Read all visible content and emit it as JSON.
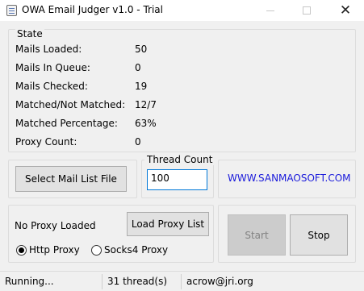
{
  "window": {
    "title": "OWA Email Judger v1.0 - Trial",
    "min_glyph": "",
    "close_glyph": "✕"
  },
  "state": {
    "legend": "State",
    "rows": [
      {
        "label": "Mails Loaded:",
        "value": "50"
      },
      {
        "label": "Mails In Queue:",
        "value": "0"
      },
      {
        "label": "Mails Checked:",
        "value": "19"
      },
      {
        "label": "Matched/Not Matched:",
        "value": "12/7"
      },
      {
        "label": "Matched Percentage:",
        "value": "63%"
      },
      {
        "label": "Proxy Count:",
        "value": "0"
      }
    ]
  },
  "mail": {
    "select_label": "Select Mail List File"
  },
  "thread": {
    "legend": "Thread Count",
    "value": "100"
  },
  "website": "WWW.SANMAOSOFT.COM",
  "proxy": {
    "status": "No Proxy Loaded",
    "load_label": "Load Proxy List",
    "options": [
      {
        "label": "Http Proxy",
        "checked": true
      },
      {
        "label": "Socks4 Proxy",
        "checked": false
      }
    ]
  },
  "actions": {
    "start_label": "Start",
    "stop_label": "Stop"
  },
  "statusbar": {
    "status": "Running...",
    "threads": "31 thread(s)",
    "email": "acrow@jri.org"
  }
}
